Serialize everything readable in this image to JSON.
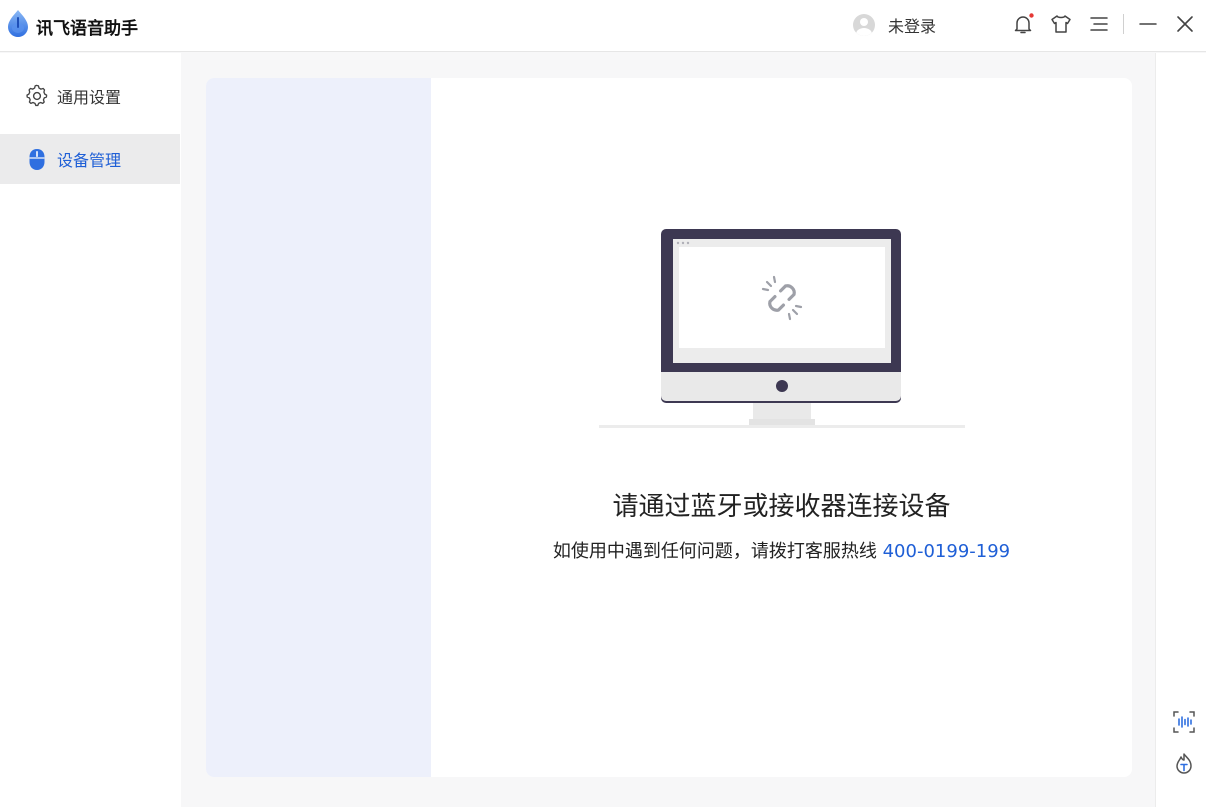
{
  "app": {
    "title": "讯飞语音助手",
    "icon": "app-logo-drop-icon",
    "accent_color": "#1f5fd6"
  },
  "titlebar": {
    "user_label": "未登录",
    "icons": [
      "bell-icon",
      "shirt-icon",
      "menu-icon",
      "minimize-icon",
      "close-icon"
    ],
    "notification_dot_color": "#e53935"
  },
  "sidebar": {
    "items": [
      {
        "label": "通用设置",
        "icon": "gear-icon",
        "active": false
      },
      {
        "label": "设备管理",
        "icon": "mouse-icon",
        "active": true
      }
    ]
  },
  "main": {
    "empty_state": {
      "title": "请通过蓝牙或接收器连接设备",
      "subtitle": "如使用中遇到任何问题，请拨打客服热线",
      "hotline": "400-0199-199",
      "illustration": "disconnected-monitor-icon"
    }
  },
  "right_rail": {
    "icons": [
      "voice-wave-icon",
      "translate-flame-icon"
    ]
  }
}
